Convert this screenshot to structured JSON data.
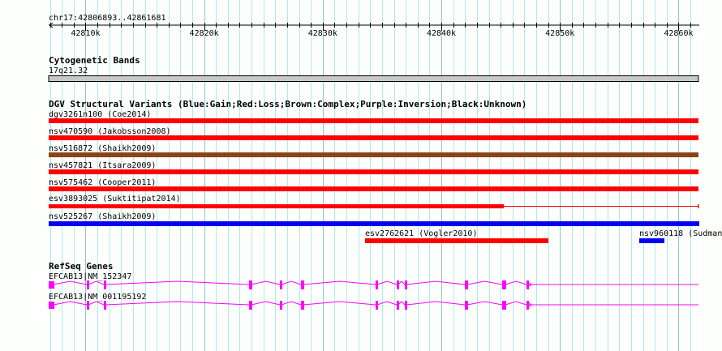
{
  "ruler": {
    "location": "chr17:42806893..42861681",
    "start": 42806893,
    "end": 42861681,
    "tick_labels": [
      "42810k",
      "42820k",
      "42830k",
      "42840k",
      "42850k",
      "42860k"
    ]
  },
  "cytobands": {
    "title": "Cytogenetic Bands",
    "band": "17q21.32"
  },
  "dgv": {
    "title": "DGV Structural Variants (Blue:Gain;Red:Loss;Brown:Complex;Purple:Inversion;Black:Unknown)",
    "colors": {
      "gain": "#0000ee",
      "loss": "#ff0000",
      "complex": "#8b4513"
    },
    "variants": [
      {
        "label": "dgv3261n100 (Coe2014)",
        "type": "loss"
      },
      {
        "label": "nsv470590 (Jakobsson2008)",
        "type": "loss"
      },
      {
        "label": "nsv516872 (Shaikh2009)",
        "type": "complex"
      },
      {
        "label": "nsv457821 (Itsara2009)",
        "type": "loss"
      },
      {
        "label": "nsv575462 (Cooper2011)",
        "type": "loss"
      },
      {
        "label": "esv3893025 (Suktitipat2014)",
        "type": "loss"
      },
      {
        "label": "nsv525267 (Shaikh2009)",
        "type": "gain"
      },
      {
        "label": "esv2762621 (Vogler2010)",
        "type": "loss"
      },
      {
        "label": "nsv960118 (Sudman",
        "type": "gain"
      }
    ]
  },
  "refseq": {
    "title": "RefSeq Genes",
    "color": "#ff00ff",
    "transcripts": [
      {
        "label": "EFCAB13|NM_152347"
      },
      {
        "label": "EFCAB13|NM_001195192"
      }
    ]
  }
}
